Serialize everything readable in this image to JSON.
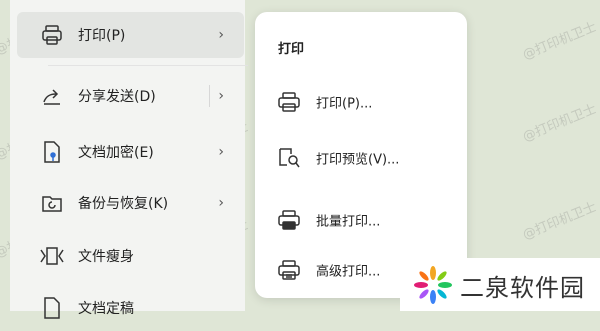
{
  "left_menu": {
    "items": [
      {
        "label": "打印(P)",
        "icon": "printer-icon",
        "has_submenu": true,
        "active": true
      },
      {
        "label": "分享发送(D)",
        "icon": "share-icon",
        "has_submenu": true
      },
      {
        "label": "文档加密(E)",
        "icon": "encrypt-document-icon",
        "has_submenu": true
      },
      {
        "label": "备份与恢复(K)",
        "icon": "backup-restore-icon",
        "has_submenu": true
      },
      {
        "label": "文件瘦身",
        "icon": "file-slim-icon",
        "has_submenu": false
      },
      {
        "label": "文档定稿",
        "icon": "document-finalize-icon",
        "has_submenu": false
      }
    ],
    "chevron": "›"
  },
  "submenu": {
    "title": "打印",
    "items": [
      {
        "label": "打印(P)...",
        "icon": "printer-icon"
      },
      {
        "label": "打印预览(V)...",
        "icon": "print-preview-icon"
      },
      {
        "label": "批量打印...",
        "icon": "batch-print-icon"
      },
      {
        "label": "高级打印...",
        "icon": "advanced-print-icon"
      }
    ]
  },
  "watermark": "@打印机卫士",
  "brand": {
    "name": "二泉软件园",
    "icon": "colorful-flower-logo"
  },
  "colors": {
    "background": "#dfe6d6",
    "menu_bg": "#f3f4f2",
    "active_bg": "#e3e5e2",
    "submenu_bg": "#ffffff"
  }
}
